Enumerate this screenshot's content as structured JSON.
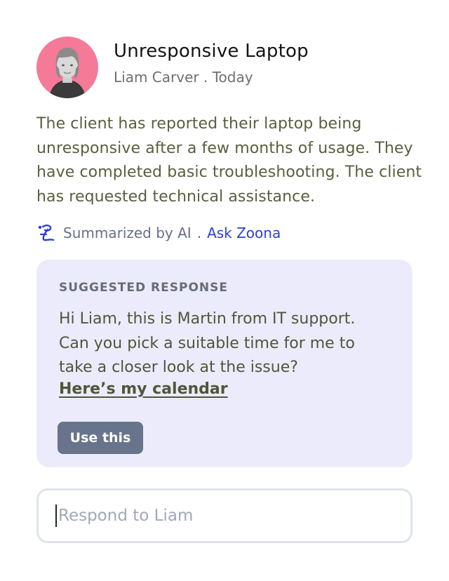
{
  "header": {
    "title": "Unresponsive Laptop",
    "author": "Liam Carver",
    "separator": ".",
    "date": "Today"
  },
  "summary": {
    "text": "The client has reported their laptop being unresponsive after a few months of usage. They have completed basic troubleshooting. The client has requested technical assistance."
  },
  "ai": {
    "icon": "zoona-logo-icon",
    "label": "Summarized by AI",
    "separator": ".",
    "link_label": "Ask Zoona"
  },
  "suggestion": {
    "label": "SUGGESTED RESPONSE",
    "body": "Hi Liam, this is Martin from IT support. Can you pick a suitable time for me to take a closer look at the issue?",
    "link_label": "Here’s my calendar",
    "button_label": "Use this"
  },
  "reply": {
    "placeholder": "Respond to Liam",
    "value": ""
  },
  "colors": {
    "avatar_bg": "#f47a98",
    "card_bg": "#ebebfb",
    "button_bg": "#67748b",
    "link": "#2b3fd6",
    "body_text": "#5a5e3f"
  }
}
